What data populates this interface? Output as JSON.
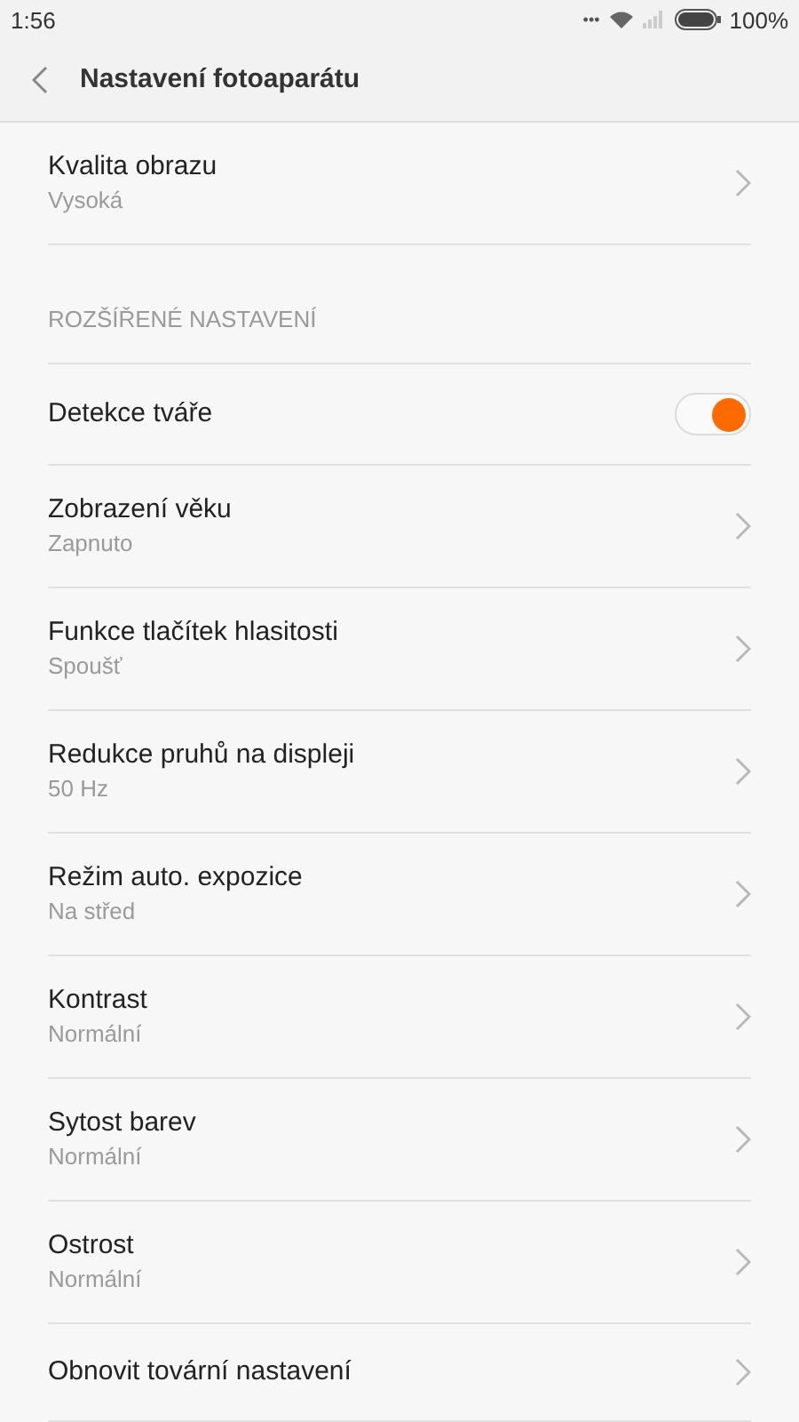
{
  "status_bar": {
    "time": "1:56",
    "more": "•••",
    "battery_text": "100%"
  },
  "header": {
    "title": "Nastavení fotoaparátu"
  },
  "items": [
    {
      "kind": "nav",
      "title": "Kvalita obrazu",
      "subtitle": "Vysoká"
    },
    {
      "kind": "section",
      "title": "ROZŠÍŘENÉ NASTAVENÍ"
    },
    {
      "kind": "toggle",
      "title": "Detekce tváře",
      "on": true
    },
    {
      "kind": "nav",
      "title": "Zobrazení věku",
      "subtitle": "Zapnuto"
    },
    {
      "kind": "nav",
      "title": "Funkce tlačítek hlasitosti",
      "subtitle": "Spoušť"
    },
    {
      "kind": "nav",
      "title": "Redukce pruhů na displeji",
      "subtitle": "50 Hz"
    },
    {
      "kind": "nav",
      "title": "Režim auto. expozice",
      "subtitle": "Na střed"
    },
    {
      "kind": "nav",
      "title": "Kontrast",
      "subtitle": "Normální"
    },
    {
      "kind": "nav",
      "title": "Sytost barev",
      "subtitle": "Normální"
    },
    {
      "kind": "nav",
      "title": "Ostrost",
      "subtitle": "Normální"
    },
    {
      "kind": "nav",
      "title": "Obnovit tovární nastavení"
    }
  ]
}
